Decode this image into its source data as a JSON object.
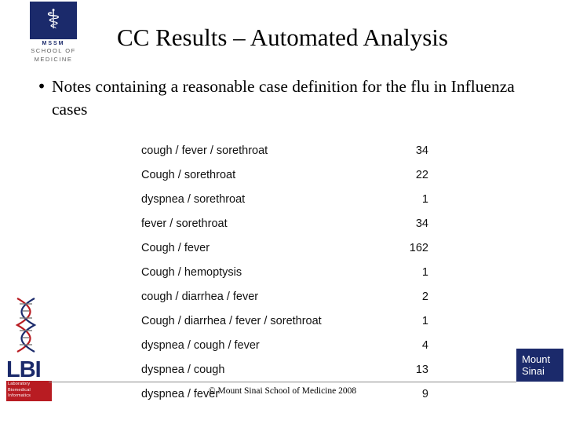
{
  "slide": {
    "title": "CC Results – Automated Analysis",
    "bullet_marker": "•",
    "bullet_text": "Notes containing a reasonable case definition for the flu in Influenza cases",
    "copyright": "© Mount Sinai School of Medicine 2008"
  },
  "crest": {
    "icon": "caduceus-icon",
    "glyph": "⚕",
    "name": "MSSM",
    "line1": "SCHOOL OF",
    "line2": "MEDICINE"
  },
  "lbi_logo": {
    "icon": "dna-helix-icon",
    "title": "LBI",
    "bar_line1": "Laboratory",
    "bar_line2": "Biomedical",
    "bar_line3": "Informatics"
  },
  "mount_sinai_wordmark": {
    "line1": "Mount",
    "line2": "Sinai"
  },
  "table": {
    "rows": [
      {
        "label": "cough / fever / sorethroat",
        "value": "34"
      },
      {
        "label": "Cough / sorethroat",
        "value": "22"
      },
      {
        "label": "dyspnea / sorethroat",
        "value": "1"
      },
      {
        "label": "fever / sorethroat",
        "value": "34"
      },
      {
        "label": "Cough / fever",
        "value": "162"
      },
      {
        "label": "Cough / hemoptysis",
        "value": "1"
      },
      {
        "label": "cough  / diarrhea / fever",
        "value": "2"
      },
      {
        "label": "Cough / diarrhea / fever / sorethroat",
        "value": "1"
      },
      {
        "label": "dyspnea / cough / fever",
        "value": "4"
      },
      {
        "label": "dyspnea / cough",
        "value": "13"
      },
      {
        "label": "dyspnea / fever",
        "value": "9"
      }
    ]
  }
}
